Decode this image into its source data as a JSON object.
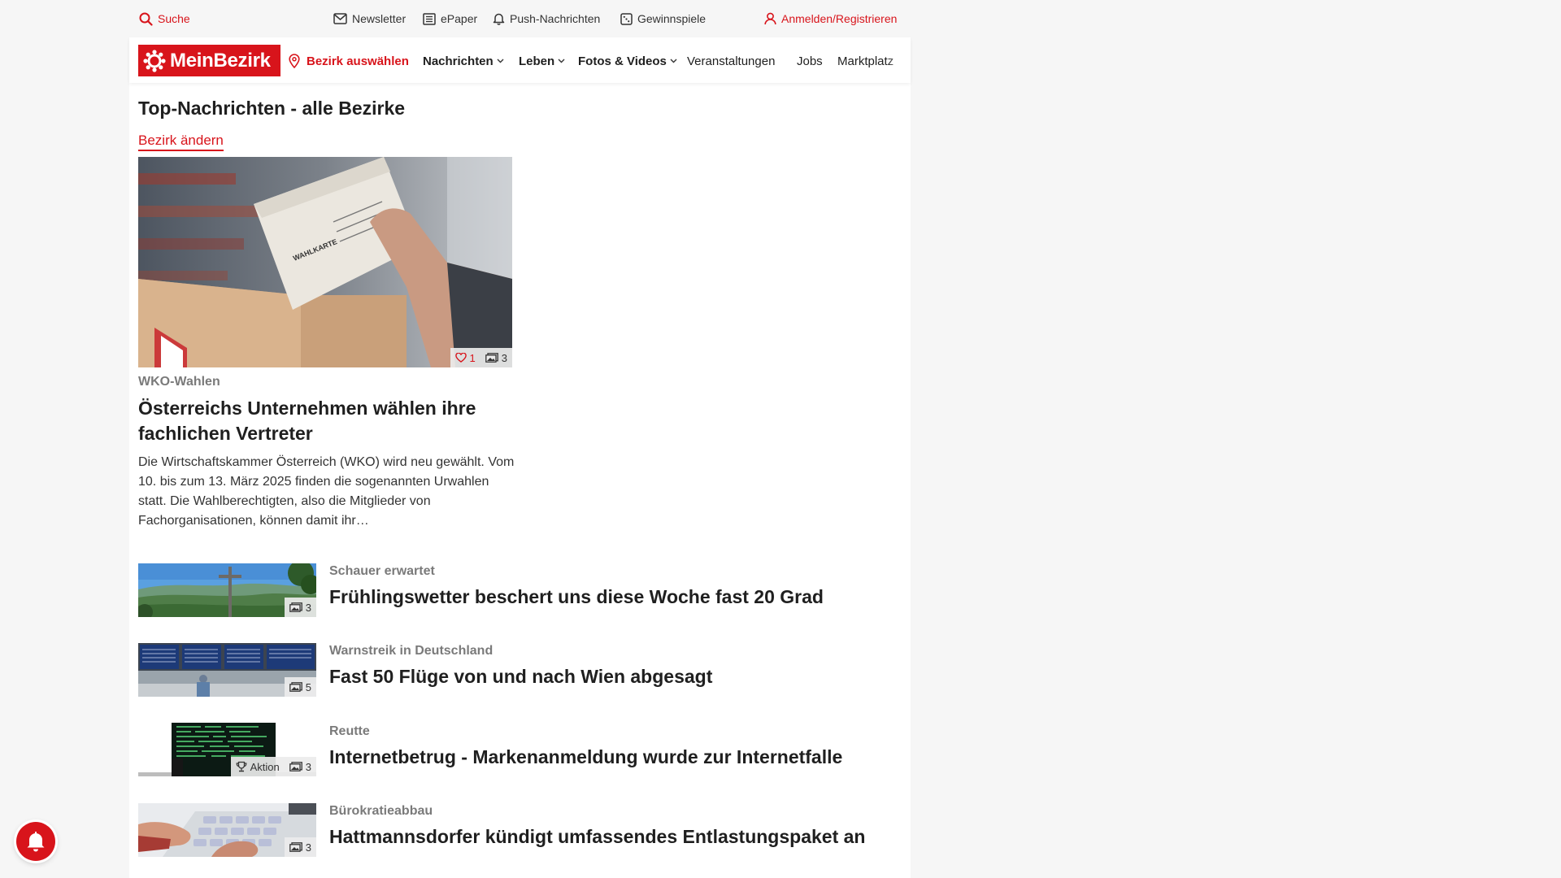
{
  "topbar": {
    "search": "Suche",
    "newsletter": "Newsletter",
    "epaper": "ePaper",
    "push": "Push-Nachrichten",
    "gewinnspiele": "Gewinnspiele",
    "login": "Anmelden/Registrieren"
  },
  "nav": {
    "logo": "MeinBezirk",
    "bezirk": "Bezirk auswählen",
    "items": [
      "Nachrichten",
      "Leben",
      "Fotos & Videos",
      "Veranstaltungen",
      "Jobs",
      "Marktplatz"
    ]
  },
  "section": {
    "title": "Top-Nachrichten - alle Bezirke",
    "change_link": "Bezirk ändern"
  },
  "hero": {
    "image_text": "WAHLKARTE",
    "likes": "1",
    "photos": "3",
    "kicker": "WKO-Wahlen",
    "title": "Österreichs Unternehmen wählen ihre fachlichen Vertreter",
    "text": "Die Wirtschaftskammer Österreich (WKO) wird neu gewählt. Vom 10. bis zum 13. März 2025 finden die sogenannten Urwahlen statt. Die Wahlberechtigten, also die Mitglieder von Fachorganisationen, können damit ihr…"
  },
  "articles": [
    {
      "kicker": "Schauer erwartet",
      "title": "Frühlingswetter beschert uns diese Woche fast 20 Grad",
      "photos": "3"
    },
    {
      "kicker": "Warnstreik in Deutschland",
      "title": "Fast 50 Flüge von und nach Wien abgesagt",
      "photos": "5"
    },
    {
      "kicker": "Reutte",
      "title": "Internetbetrug - Markenanmeldung wurde zur Internetfalle",
      "photos": "3",
      "tag": "Aktion"
    },
    {
      "kicker": "Bürokratieabbau",
      "title": "Hattmannsdorfer kündigt umfassendes Entlastungspaket an",
      "photos": "3"
    }
  ],
  "colors": {
    "brand": "#d8141b",
    "kicker": "#7a7a7a",
    "background": "#f6f6f6"
  }
}
